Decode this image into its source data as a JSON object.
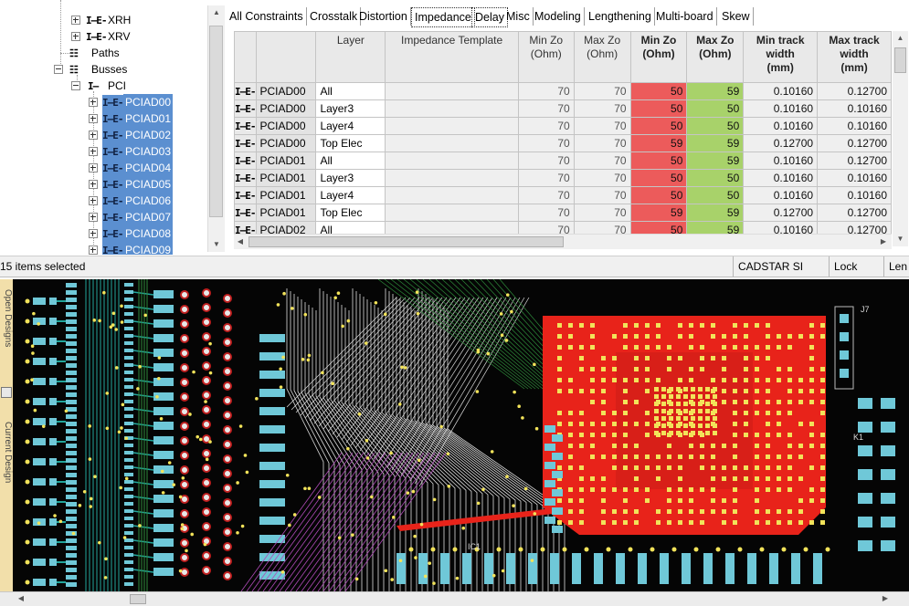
{
  "tree": {
    "items": [
      {
        "label": "XRH",
        "icon": "net-icon",
        "expander": "plus",
        "selected": false
      },
      {
        "label": "XRV",
        "icon": "net-icon",
        "expander": "plus",
        "selected": false
      },
      {
        "label": "Paths",
        "icon": "paths-icon",
        "expander": "none",
        "selected": false
      },
      {
        "label": "Busses",
        "icon": "busses-icon",
        "expander": "minus",
        "selected": false
      },
      {
        "label": "PCI",
        "icon": "bus-icon",
        "expander": "minus",
        "selected": false
      },
      {
        "label": "PCIAD00",
        "icon": "net-icon",
        "expander": "plus",
        "selected": true
      },
      {
        "label": "PCIAD01",
        "icon": "net-icon",
        "expander": "plus",
        "selected": true
      },
      {
        "label": "PCIAD02",
        "icon": "net-icon",
        "expander": "plus",
        "selected": true
      },
      {
        "label": "PCIAD03",
        "icon": "net-icon",
        "expander": "plus",
        "selected": true
      },
      {
        "label": "PCIAD04",
        "icon": "net-icon",
        "expander": "plus",
        "selected": true
      },
      {
        "label": "PCIAD05",
        "icon": "net-icon",
        "expander": "plus",
        "selected": true
      },
      {
        "label": "PCIAD06",
        "icon": "net-icon",
        "expander": "plus",
        "selected": true
      },
      {
        "label": "PCIAD07",
        "icon": "net-icon",
        "expander": "plus",
        "selected": true
      },
      {
        "label": "PCIAD08",
        "icon": "net-icon",
        "expander": "plus",
        "selected": true
      },
      {
        "label": "PCIAD09",
        "icon": "net-icon",
        "expander": "plus",
        "selected": true
      }
    ],
    "net_glyph": "I—E-",
    "bus_glyph": "I—",
    "folder_glyph": "☷"
  },
  "tabs": [
    "All Constraints",
    "Crosstalk",
    "Distortion",
    "Impedance",
    "Delay",
    "Misc",
    "Modeling",
    "Lengthening",
    "Multi-board",
    "Skew"
  ],
  "active_tab": "Impedance",
  "grid": {
    "columns": [
      "",
      "",
      "Layer",
      "Impedance Template",
      "Min Zo\n(Ohm)",
      "Max Zo\n(Ohm)",
      "Min Zo\n(Ohm)",
      "Max Zo\n(Ohm)",
      "Min track\nwidth\n(mm)",
      "Max track\nwidth\n(mm)"
    ],
    "row_glyph": "I—E-",
    "rows": [
      {
        "net": "PCIAD00",
        "layer": "All",
        "template": "",
        "min_zo": "70",
        "max_zo": "70",
        "min_zo_act": "50",
        "max_zo_act": "59",
        "min_w": "0.10160",
        "max_w": "0.12700"
      },
      {
        "net": "PCIAD00",
        "layer": "Layer3",
        "template": "",
        "min_zo": "70",
        "max_zo": "70",
        "min_zo_act": "50",
        "max_zo_act": "50",
        "min_w": "0.10160",
        "max_w": "0.10160"
      },
      {
        "net": "PCIAD00",
        "layer": "Layer4",
        "template": "",
        "min_zo": "70",
        "max_zo": "70",
        "min_zo_act": "50",
        "max_zo_act": "50",
        "min_w": "0.10160",
        "max_w": "0.10160"
      },
      {
        "net": "PCIAD00",
        "layer": "Top Elec",
        "template": "",
        "min_zo": "70",
        "max_zo": "70",
        "min_zo_act": "59",
        "max_zo_act": "59",
        "min_w": "0.12700",
        "max_w": "0.12700"
      },
      {
        "net": "PCIAD01",
        "layer": "All",
        "template": "",
        "min_zo": "70",
        "max_zo": "70",
        "min_zo_act": "50",
        "max_zo_act": "59",
        "min_w": "0.10160",
        "max_w": "0.12700"
      },
      {
        "net": "PCIAD01",
        "layer": "Layer3",
        "template": "",
        "min_zo": "70",
        "max_zo": "70",
        "min_zo_act": "50",
        "max_zo_act": "50",
        "min_w": "0.10160",
        "max_w": "0.10160"
      },
      {
        "net": "PCIAD01",
        "layer": "Layer4",
        "template": "",
        "min_zo": "70",
        "max_zo": "70",
        "min_zo_act": "50",
        "max_zo_act": "50",
        "min_w": "0.10160",
        "max_w": "0.10160"
      },
      {
        "net": "PCIAD01",
        "layer": "Top Elec",
        "template": "",
        "min_zo": "70",
        "max_zo": "70",
        "min_zo_act": "59",
        "max_zo_act": "59",
        "min_w": "0.12700",
        "max_w": "0.12700"
      },
      {
        "net": "PCIAD02",
        "layer": "All",
        "template": "",
        "min_zo": "70",
        "max_zo": "70",
        "min_zo_act": "50",
        "max_zo_act": "59",
        "min_w": "0.10160",
        "max_w": "0.12700"
      }
    ]
  },
  "status": {
    "selection": "15 items selected",
    "app": "CADSTAR SI Verify",
    "lock": "Lock",
    "len": "Len"
  },
  "side_tabs": [
    "Open Designs",
    "Current Design"
  ],
  "pcb": {
    "labels": [
      "J7",
      "K1",
      "IC1"
    ],
    "colors": {
      "background": "#050505",
      "copper": "#e8231a",
      "pads": "#6fc8d8",
      "vias": "#f2e35a",
      "traces": "#dcdcdc",
      "teal": "#22a59b",
      "green": "#2e8b3a",
      "magenta": "#b04ab8"
    }
  }
}
